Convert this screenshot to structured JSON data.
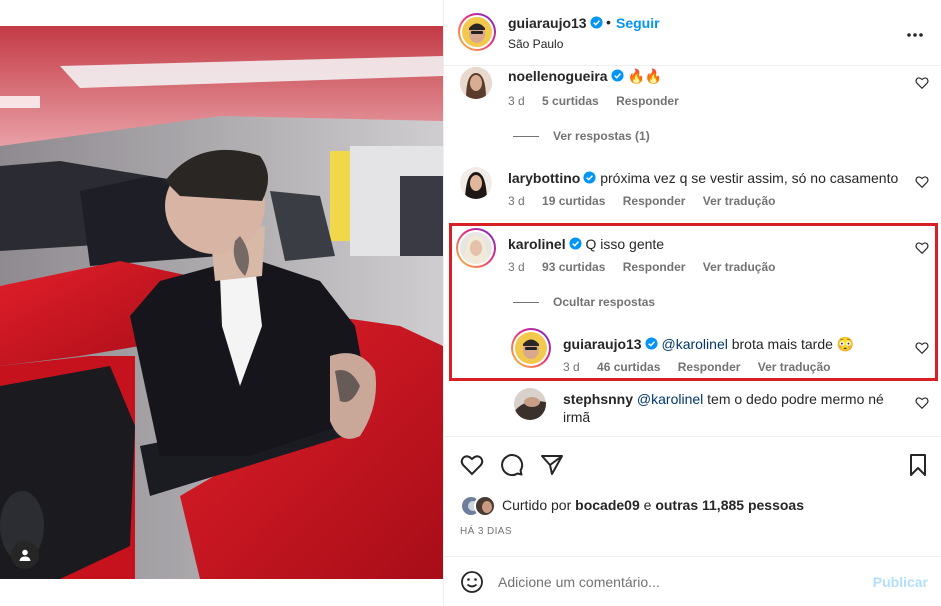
{
  "header": {
    "username": "guiaraujo13",
    "separator": "•",
    "follow_label": "Seguir",
    "location": "São Paulo",
    "more_icon": "more-horizontal-icon"
  },
  "comments": [
    {
      "username": "noellenogueira",
      "text": "🔥🔥",
      "age": "3 d",
      "likes": "5 curtidas",
      "reply_label": "Responder",
      "view_replies": "Ver respostas (1)"
    },
    {
      "username": "larybottino",
      "text": "próxima vez q se vestir assim, só no casamento",
      "age": "3 d",
      "likes": "19 curtidas",
      "reply_label": "Responder",
      "translate_label": "Ver tradução"
    },
    {
      "username": "karolinel",
      "text": "Q isso gente",
      "age": "3 d",
      "likes": "93 curtidas",
      "reply_label": "Responder",
      "translate_label": "Ver tradução",
      "hide_replies": "Ocultar respostas",
      "replies": [
        {
          "username": "guiaraujo13",
          "mention": "@karolinel",
          "text": "brota mais tarde 😳",
          "age": "3 d",
          "likes": "46 curtidas",
          "reply_label": "Responder",
          "translate_label": "Ver tradução"
        },
        {
          "username": "stephsnny",
          "mention": "@karolinel",
          "text": "tem o dedo podre mermo né",
          "text_line2": "irmã"
        }
      ]
    }
  ],
  "likes": {
    "prefix": "Curtido por",
    "user": "bocade09",
    "connector": "e",
    "others": "outras 11,885 pessoas"
  },
  "timestamp": "HÁ 3 DIAS",
  "add_comment": {
    "placeholder": "Adicione um comentário...",
    "publish_label": "Publicar"
  },
  "colors": {
    "accent": "#0095f6",
    "highlight": "#d91f26",
    "publish_disabled": "#b2dffc",
    "secondary_text": "#737373"
  },
  "icons": [
    "heart-icon",
    "comment-icon",
    "share-icon",
    "save-icon",
    "emoji-icon",
    "verified-icon",
    "user-tag-icon"
  ]
}
